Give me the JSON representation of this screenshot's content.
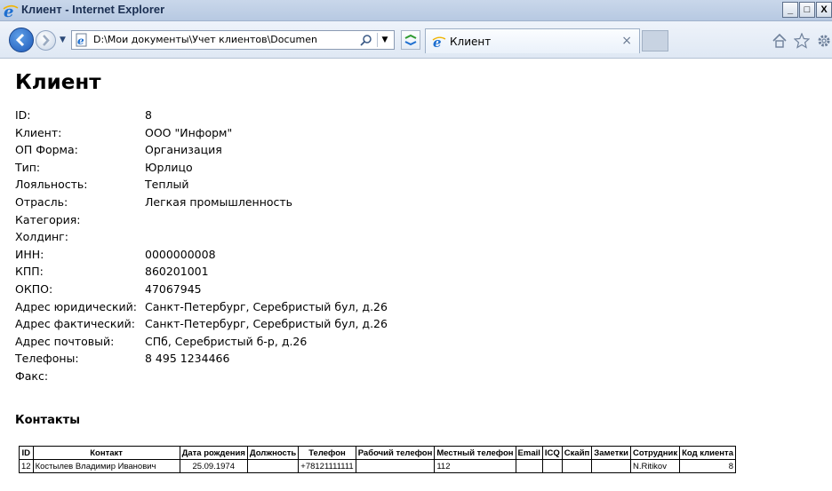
{
  "window": {
    "title": "Клиент - Internet Explorer",
    "buttons": [
      "_",
      "□",
      "X"
    ]
  },
  "nav": {
    "address": "D:\\Мои документы\\Учет клиентов\\Documen",
    "tab_label": "Клиент",
    "tab_close": "×",
    "dropdown": "▼"
  },
  "page": {
    "heading": "Клиент",
    "fields": [
      {
        "label": "ID:",
        "value": "8"
      },
      {
        "label": "Клиент:",
        "value": "ООО \"Информ\""
      },
      {
        "label": "ОП Форма:",
        "value": "Организация"
      },
      {
        "label": "Тип:",
        "value": "Юрлицо"
      },
      {
        "label": "Лояльность:",
        "value": "Теплый"
      },
      {
        "label": "Отрасль:",
        "value": "Легкая промышленность"
      },
      {
        "label": "Категория:",
        "value": ""
      },
      {
        "label": "Холдинг:",
        "value": ""
      },
      {
        "label": "ИНН:",
        "value": "0000000008"
      },
      {
        "label": "КПП:",
        "value": "860201001"
      },
      {
        "label": "ОКПО:",
        "value": "47067945"
      },
      {
        "label": "Адрес юридический:",
        "value": "Санкт-Петербург, Серебристый бул, д.26"
      },
      {
        "label": "Адрес фактический:",
        "value": "Санкт-Петербург, Серебристый бул, д.26"
      },
      {
        "label": "Адрес почтовый:",
        "value": "СПб, Серебристый б-р, д.26"
      },
      {
        "label": "Телефоны:",
        "value": "8 495 1234466"
      },
      {
        "label": "Факс:",
        "value": ""
      }
    ],
    "contacts_heading": "Контакты",
    "contacts_table": {
      "columns": [
        "ID",
        "Контакт",
        "Дата рождения",
        "Должность",
        "Телефон",
        "Рабочий телефон",
        "Местный телефон",
        "Email",
        "ICQ",
        "Скайп",
        "Заметки",
        "Сотрудник",
        "Код клиента"
      ],
      "rows": [
        [
          "12",
          "Костылев Владимир Иванович",
          "25.09.1974",
          "",
          "+78121111111",
          "",
          "112",
          "",
          "",
          "",
          "",
          "N.Ritikov",
          "8"
        ]
      ]
    }
  },
  "icons": [
    "ie-icon",
    "back-icon",
    "forward-icon",
    "page-icon",
    "search-icon",
    "compatibility-icon",
    "home-icon",
    "star-icon",
    "gear-icon"
  ]
}
